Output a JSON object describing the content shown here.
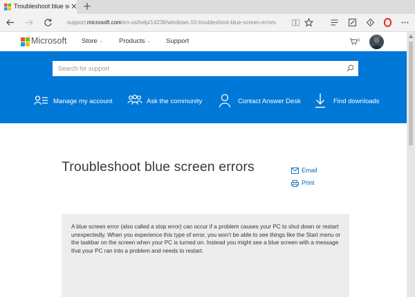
{
  "browser": {
    "tab_title": "Troubleshoot blue scre",
    "url_prefix": "support.",
    "url_host": "microsoft.com",
    "url_path": "/en-us/help/14238/windows-10-troubleshoot-blue-screen-errors"
  },
  "header": {
    "brand": "Microsoft",
    "nav": [
      {
        "label": "Store",
        "caret": "⌄"
      },
      {
        "label": "Products",
        "caret": "⌄"
      },
      {
        "label": "Support",
        "caret": ""
      }
    ],
    "cart_count": "0"
  },
  "hero": {
    "search_placeholder": "Search for support",
    "quick_links": [
      {
        "label": "Manage my account",
        "icon": "account-list-icon"
      },
      {
        "label": "Ask the community",
        "icon": "community-icon"
      },
      {
        "label": "Contact Answer Desk",
        "icon": "person-icon"
      },
      {
        "label": "Find downloads",
        "icon": "download-icon"
      }
    ]
  },
  "article": {
    "title": "Troubleshoot blue screen errors",
    "share": [
      {
        "label": "Email",
        "icon": "email-icon"
      },
      {
        "label": "Print",
        "icon": "print-icon"
      }
    ],
    "summary": "A blue screen error (also called a stop error) can occur if a problem causes your PC to shut down or restart unexpectedly. When you experience this type of error, you won't be able to see things like the Start menu or the taskbar on the screen when your PC is turned on. Instead you might see a blue screen with a message that your PC ran into a problem and needs to restart."
  },
  "colors": {
    "brand_blue": "#0078d7",
    "link_blue": "#0067b8",
    "logo_red": "#f25022",
    "logo_green": "#7fba00",
    "logo_blue": "#00a4ef",
    "logo_yellow": "#ffb900",
    "opera_red": "#e8262b"
  }
}
